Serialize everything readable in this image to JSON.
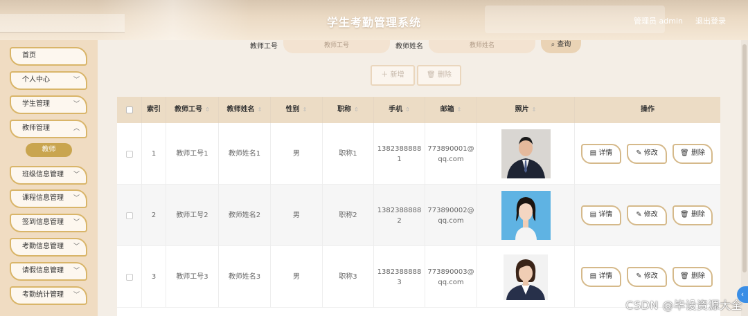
{
  "header": {
    "title": "学生考勤管理系统",
    "user": "管理员 admin",
    "logout": "退出登录"
  },
  "sidebar": {
    "items": [
      {
        "label": "首页",
        "chevron": false
      },
      {
        "label": "个人中心",
        "chevron": true
      },
      {
        "label": "学生管理",
        "chevron": true
      },
      {
        "label": "教师管理",
        "chevron": true
      },
      {
        "label": "班级信息管理",
        "chevron": true
      },
      {
        "label": "课程信息管理",
        "chevron": true
      },
      {
        "label": "签到信息管理",
        "chevron": true
      },
      {
        "label": "考勤信息管理",
        "chevron": true
      },
      {
        "label": "请假信息管理",
        "chevron": true
      },
      {
        "label": "考勤统计管理",
        "chevron": true
      }
    ],
    "active_sub": "教师"
  },
  "search": {
    "teacher_no_label": "教师工号",
    "teacher_no_placeholder": "教师工号",
    "teacher_name_label": "教师姓名",
    "teacher_name_placeholder": "教师姓名",
    "search_label": "查询"
  },
  "actions": {
    "add_label": "新增",
    "delete_label": "删除"
  },
  "table": {
    "columns": [
      "索引",
      "教师工号",
      "教师姓名",
      "性别",
      "职称",
      "手机",
      "邮箱",
      "照片",
      "操作"
    ],
    "rows": [
      {
        "index": "1",
        "no": "教师工号1",
        "name": "教师姓名1",
        "gender": "男",
        "title": "职称1",
        "phone1": "1382388888",
        "phone2": "1",
        "email1": "773890001@",
        "email2": "qq.com"
      },
      {
        "index": "2",
        "no": "教师工号2",
        "name": "教师姓名2",
        "gender": "男",
        "title": "职称2",
        "phone1": "1382388888",
        "phone2": "2",
        "email1": "773890002@",
        "email2": "qq.com"
      },
      {
        "index": "3",
        "no": "教师工号3",
        "name": "教师姓名3",
        "gender": "男",
        "title": "职称3",
        "phone1": "1382388888",
        "phone2": "3",
        "email1": "773890003@",
        "email2": "qq.com"
      }
    ],
    "ops": {
      "detail": "详情",
      "edit": "修改",
      "delete": "删除"
    }
  },
  "watermark": "CSDN @毕设资源大全",
  "colors": {
    "accent": "#c9a54f",
    "header_bg": "#ecdcc5",
    "float_button": "#3a8ee6"
  }
}
